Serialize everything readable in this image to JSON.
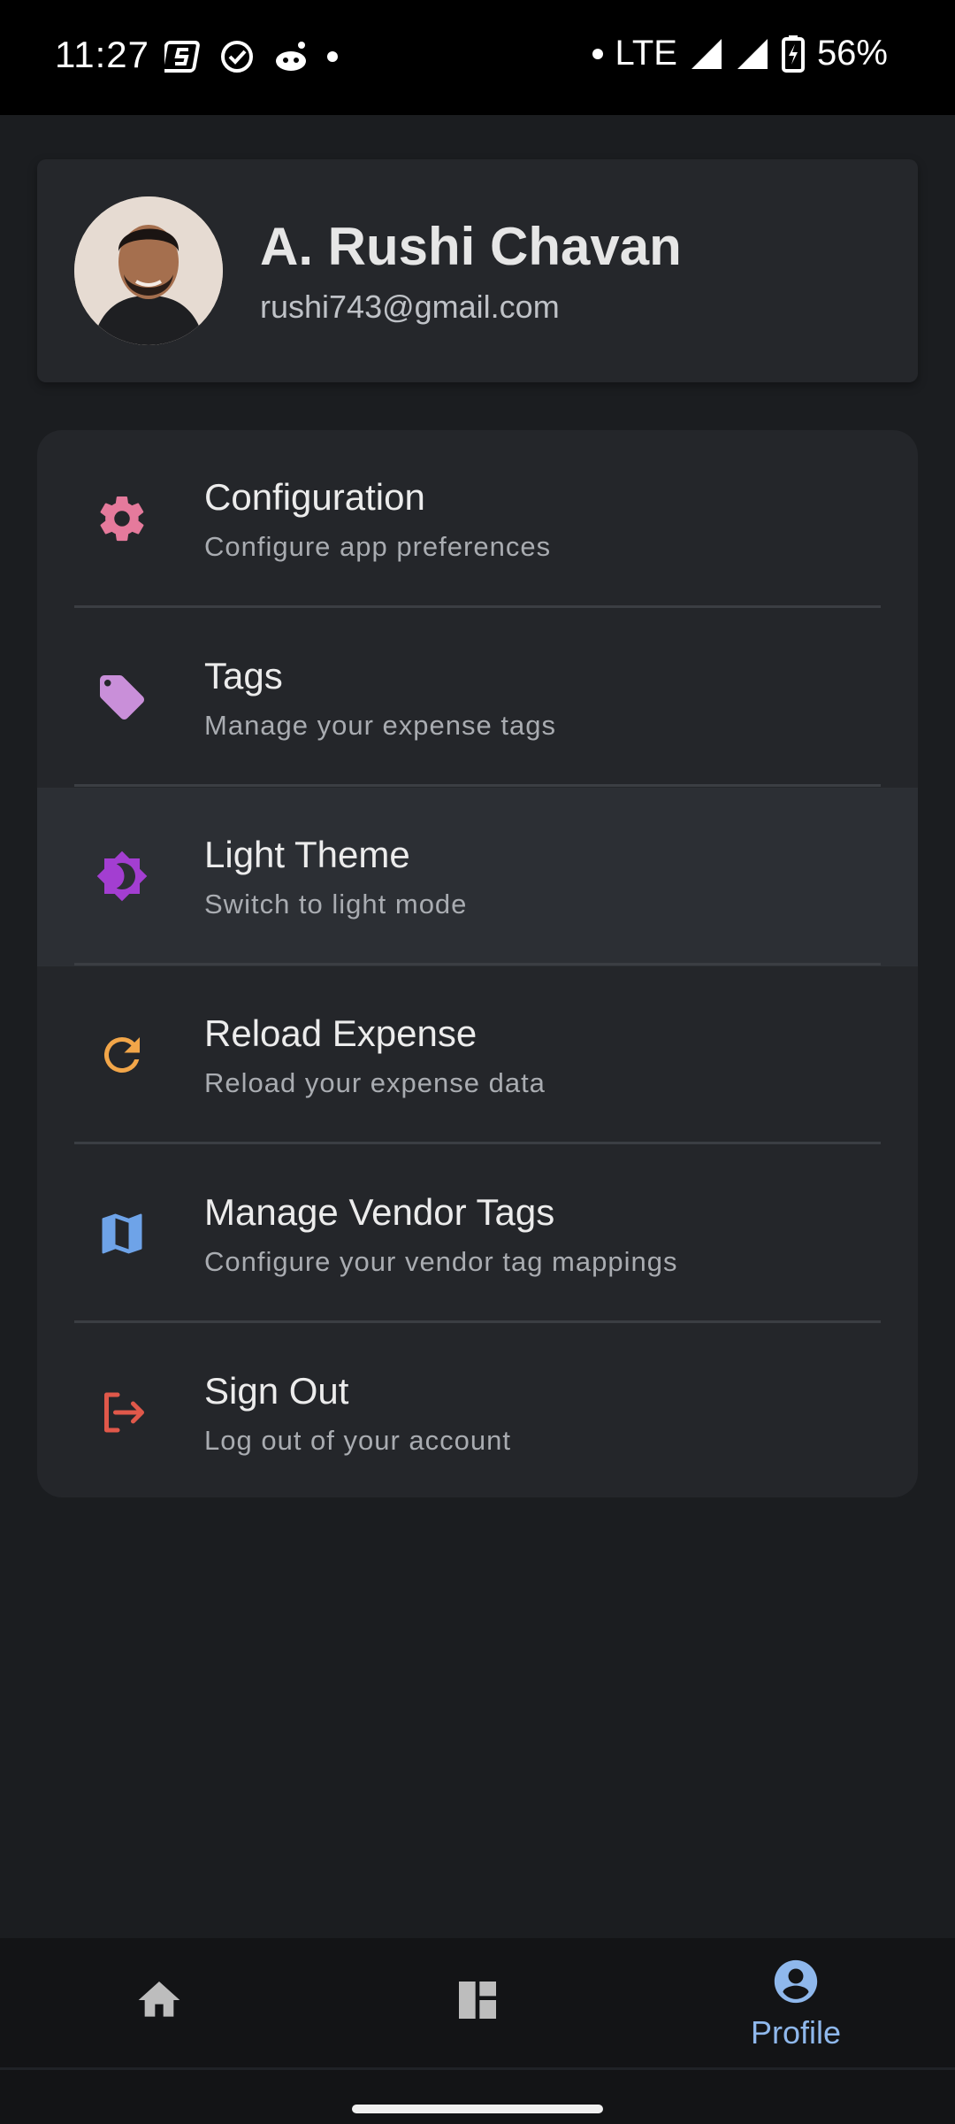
{
  "status_bar": {
    "time": "11:27",
    "network": "LTE",
    "battery": "56%"
  },
  "profile": {
    "name": "A. Rushi Chavan",
    "email": "rushi743@gmail.com"
  },
  "menu": [
    {
      "title": "Configuration",
      "subtitle": "Configure app preferences",
      "icon": "gear-icon",
      "color": "#e57a9c"
    },
    {
      "title": "Tags",
      "subtitle": "Manage your expense tags",
      "icon": "tag-icon",
      "color": "#c98fd9"
    },
    {
      "title": "Light Theme",
      "subtitle": "Switch to light mode",
      "icon": "brightness-icon",
      "color": "#a33ed1"
    },
    {
      "title": "Reload Expense",
      "subtitle": "Reload your expense data",
      "icon": "reload-icon",
      "color": "#f2a649"
    },
    {
      "title": "Manage Vendor Tags",
      "subtitle": "Configure your vendor tag mappings",
      "icon": "map-icon",
      "color": "#6ea3e8"
    },
    {
      "title": "Sign Out",
      "subtitle": "Log out of your account",
      "icon": "logout-icon",
      "color": "#e0584a"
    }
  ],
  "bottom_nav": {
    "home_icon": "home-icon",
    "dashboard_icon": "dashboard-icon",
    "profile_label": "Profile",
    "active_color": "#8fb8ec",
    "inactive_color": "#bdbdbd"
  }
}
